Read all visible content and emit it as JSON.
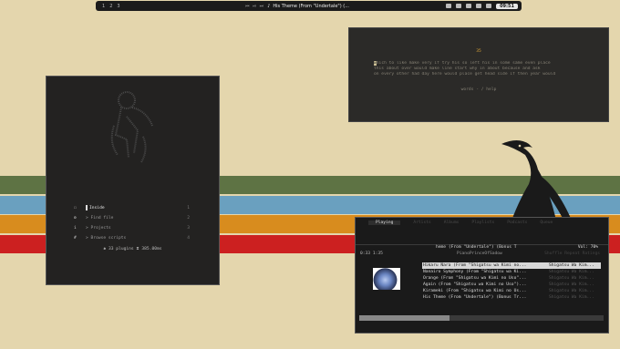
{
  "topbar": {
    "workspaces": [
      "1",
      "2",
      "3"
    ],
    "media_controls": "⏮ ⏯ ⏭",
    "now_playing": "His Theme (From \"Undertale\") (...",
    "clock": "09:51"
  },
  "editor": {
    "number": "35",
    "cursor_char": "w",
    "lines": [
      "hich to like make very if try his so left his in some same even place",
      "this about over would make line start why in about because and ask",
      "on every other had day here would place get head side if then year would"
    ],
    "footer": "words - / help"
  },
  "launcher": {
    "items": [
      {
        "icon": "☐",
        "label": "Inside",
        "key": "1"
      },
      {
        "icon": "⚙",
        "label": "> Find file",
        "key": "2"
      },
      {
        "icon": "i",
        "label": "> Projects",
        "key": "3"
      },
      {
        "icon": "#",
        "label": "> Browse scripts",
        "key": "4"
      }
    ],
    "stats": "✱ 33 plugins  ⧗ 385.00ms"
  },
  "player": {
    "tabs": [
      "Playing",
      "Artists",
      "Albums",
      "Playlists",
      "Podcasts",
      "Queue"
    ],
    "title": "heme (From \"Undertale\") (Bonus T",
    "volume": "Vol: 70%",
    "time": "0:33 1:35",
    "artist": "PianoPrinceOfSadow",
    "extra": "Shuffle  Repeat  Ratings",
    "progress": 0.37,
    "tracks": [
      {
        "title": "Hikaru Nara (From \"Shigatsu wa Kimi no...",
        "album": "Shigatsu Wa Kim..."
      },
      {
        "title": "Nanairo Symphony (From \"Shigatsu wa Ki...",
        "album": "Shigatsu Wa Kim..."
      },
      {
        "title": "Orange (From \"Shigatsu wa Kimi no Uso\"...",
        "album": "Shigatsu Wa Kim..."
      },
      {
        "title": "Again (From \"Shigatsu wa Kimi no Uso\")...",
        "album": "Shigatsu Wa Kim..."
      },
      {
        "title": "Kirameki (From \"Shigatsu wa Kimi no Us...",
        "album": "Shigatsu Wa Kim..."
      },
      {
        "title": "His Theme (From \"Undertale\") (Bonus Tr...",
        "album": "Shigatsu Wa Kim..."
      }
    ]
  }
}
